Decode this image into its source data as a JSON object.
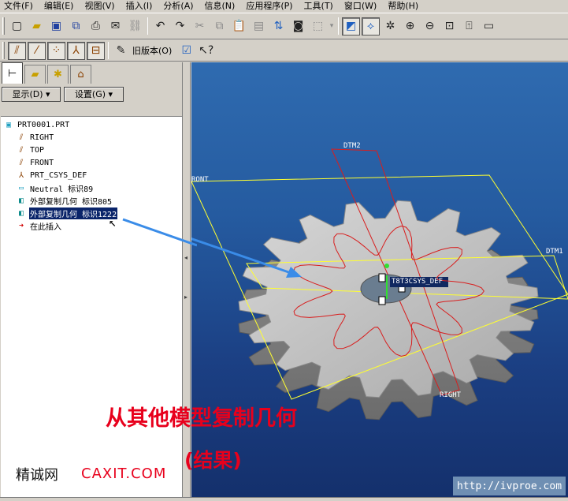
{
  "menu": [
    "文件(F)",
    "编辑(E)",
    "视图(V)",
    "插入(I)",
    "分析(A)",
    "信息(N)",
    "应用程序(P)",
    "工具(T)",
    "窗口(W)",
    "帮助(H)"
  ],
  "toolbar2": {
    "legacy_label": "旧版本(O)"
  },
  "left_panel": {
    "show_button": "显示(D) ▾",
    "settings_button": "设置(G) ▾"
  },
  "model_tree": [
    {
      "icon": "part-icon",
      "label": "PRT0001.PRT"
    },
    {
      "icon": "datum-plane-icon",
      "label": "RIGHT"
    },
    {
      "icon": "datum-plane-icon",
      "label": "TOP"
    },
    {
      "icon": "datum-plane-icon",
      "label": "FRONT"
    },
    {
      "icon": "csys-icon",
      "label": "PRT_CSYS_DEF"
    },
    {
      "icon": "neutral-icon",
      "label": "Neutral 标识89"
    },
    {
      "icon": "copy-geom-icon",
      "label": "外部复制几何 标识805"
    },
    {
      "icon": "copy-geom-icon",
      "label": "外部复制几何 标识1222",
      "selected": true
    },
    {
      "icon": "insert-arrow-icon",
      "label": "在此插入"
    }
  ],
  "viewport": {
    "labels": {
      "dtm2": "DTM2",
      "front": "RONT",
      "dtm1": "DTM1",
      "right": "RIGHT",
      "csys": "T8T3CSYS_DEF"
    },
    "colors": {
      "background_top": "#2f6bb0",
      "gear": "#c8c8c8",
      "datum": "#ffff00",
      "curve": "#d81e1e"
    }
  },
  "captions": {
    "main": "从其他模型复制几何",
    "sub": "(结果)"
  },
  "watermarks": {
    "site_cn": "精诚网",
    "site_url": "CAXIT.COM",
    "corner": "http://ivproe.com"
  }
}
